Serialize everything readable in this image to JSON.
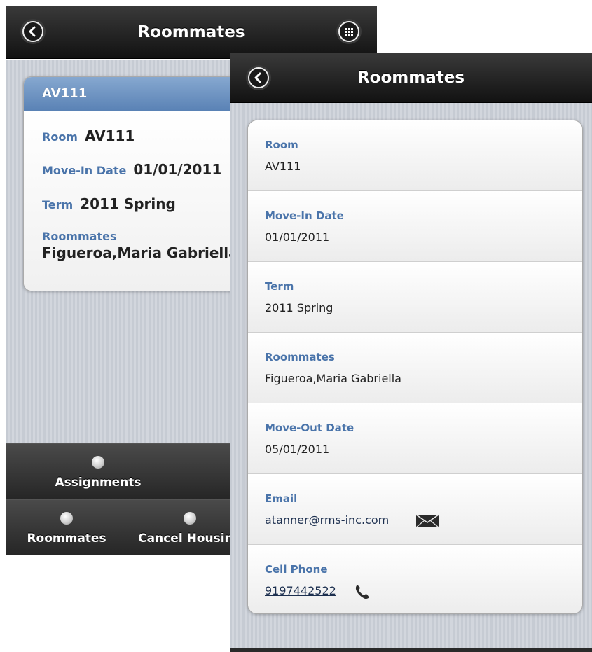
{
  "back_screen": {
    "header": {
      "title": "Roommates",
      "back_icon": "chevron-left-icon",
      "menu_icon": "grid-menu-icon"
    },
    "card": {
      "heading": "AV111",
      "room_label": "Room",
      "room_value": "AV111",
      "move_in_label": "Move-In Date",
      "move_in_value": "01/01/2011",
      "term_label": "Term",
      "term_value": "2011 Spring",
      "roommates_label": "Roommates",
      "roommates_value": "Figueroa,Maria Gabriella"
    },
    "nav": [
      {
        "label": "Assignments",
        "icon": "dot-icon"
      },
      {
        "label": "Roommates",
        "icon": "dot-icon"
      },
      {
        "label": "Cancel Housing",
        "icon": "dot-icon"
      }
    ]
  },
  "front_screen": {
    "header": {
      "title": "Roommates",
      "back_icon": "chevron-left-icon"
    },
    "details": [
      {
        "label": "Room",
        "value": "AV111"
      },
      {
        "label": "Move-In Date",
        "value": "01/01/2011"
      },
      {
        "label": "Term",
        "value": "2011 Spring"
      },
      {
        "label": "Roommates",
        "value": "Figueroa,Maria Gabriella"
      },
      {
        "label": "Move-Out Date",
        "value": "05/01/2011"
      },
      {
        "label": "Email",
        "value": "atanner@rms-inc.com",
        "icon": "envelope-icon"
      },
      {
        "label": "Cell Phone",
        "value": "9197442522",
        "icon": "phone-icon"
      }
    ]
  }
}
